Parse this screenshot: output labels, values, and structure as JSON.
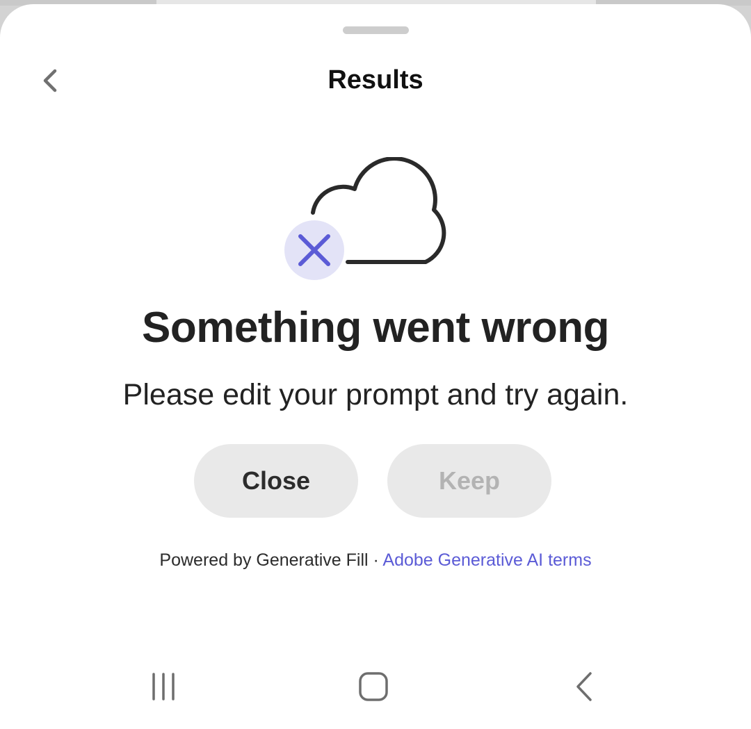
{
  "sheet": {
    "title": "Results"
  },
  "error": {
    "heading": "Something went wrong",
    "message": "Please edit your prompt and try again."
  },
  "actions": {
    "close_label": "Close",
    "keep_label": "Keep"
  },
  "footer": {
    "powered_by": "Powered by Generative Fill",
    "separator": " · ",
    "terms_link": "Adobe Generative AI terms"
  },
  "icons": {
    "back": "chevron-left-icon",
    "illustration": "cloud-error-icon",
    "nav_recents": "recents-icon",
    "nav_home": "home-icon",
    "nav_back": "back-icon"
  },
  "colors": {
    "accent": "#5b5bd6",
    "error_badge_bg": "#e3e3f7",
    "button_bg": "#e9e9e9",
    "disabled_text": "#b3b3b3"
  }
}
